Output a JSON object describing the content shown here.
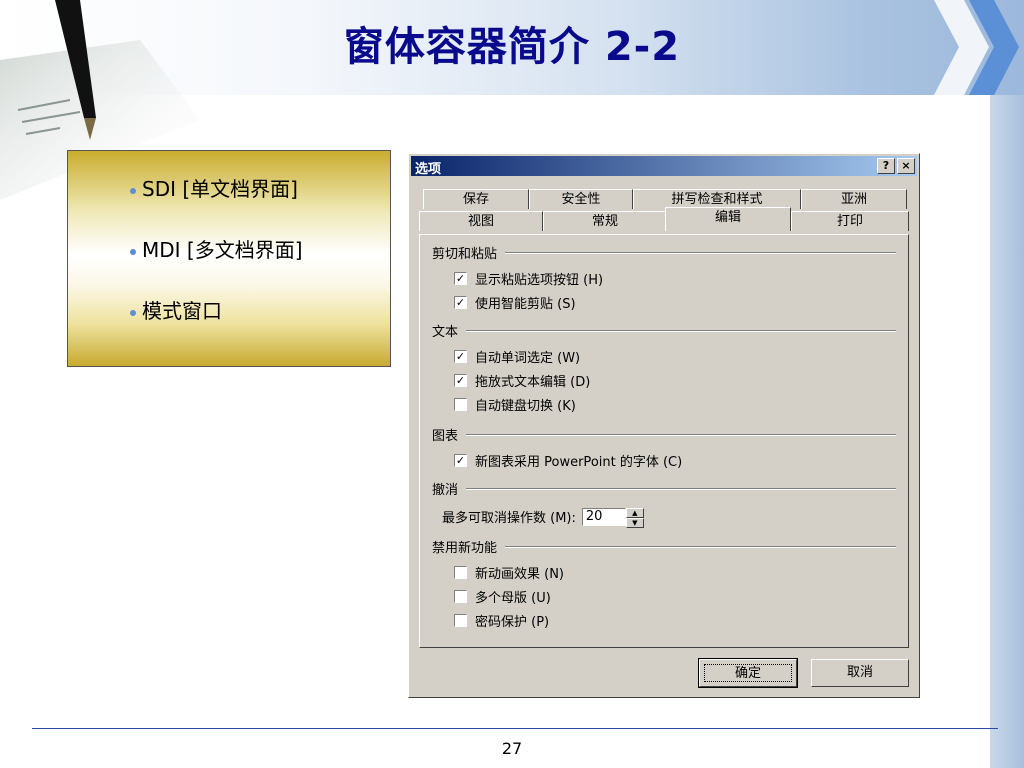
{
  "slide": {
    "title": "窗体容器简介 2-2",
    "bullets": [
      "SDI [单文档界面]",
      "MDI [多文档界面]",
      "模式窗口"
    ],
    "page_number": "27"
  },
  "dialog": {
    "title": "选项",
    "help_btn": "?",
    "close_btn": "×",
    "tabs_row1": [
      "保存",
      "安全性",
      "拼写检查和样式",
      "亚洲"
    ],
    "tabs_row2": [
      "视图",
      "常规",
      "编辑",
      "打印"
    ],
    "active_tab": "编辑",
    "groups": {
      "cut_paste": "剪切和粘贴",
      "text": "文本",
      "chart": "图表",
      "undo": "撤消",
      "disable": "禁用新功能"
    },
    "options": {
      "show_paste_btn": {
        "label": "显示粘贴选项按钮 (H)",
        "checked": true
      },
      "smart_cut": {
        "label": "使用智能剪贴 (S)",
        "checked": true
      },
      "auto_word": {
        "label": "自动单词选定 (W)",
        "checked": true
      },
      "drag_edit": {
        "label": "拖放式文本编辑 (D)",
        "checked": true
      },
      "auto_ime": {
        "label": "自动键盘切换 (K)",
        "checked": false
      },
      "new_chart_font": {
        "label": "新图表采用 PowerPoint 的字体 (C)",
        "checked": true
      },
      "new_anim": {
        "label": "新动画效果 (N)",
        "checked": false
      },
      "multi_master": {
        "label": "多个母版 (U)",
        "checked": false
      },
      "password": {
        "label": "密码保护 (P)",
        "checked": false
      }
    },
    "undo_label": "最多可取消操作数 (M):",
    "undo_value": "20",
    "ok_label": "确定",
    "cancel_label": "取消"
  }
}
